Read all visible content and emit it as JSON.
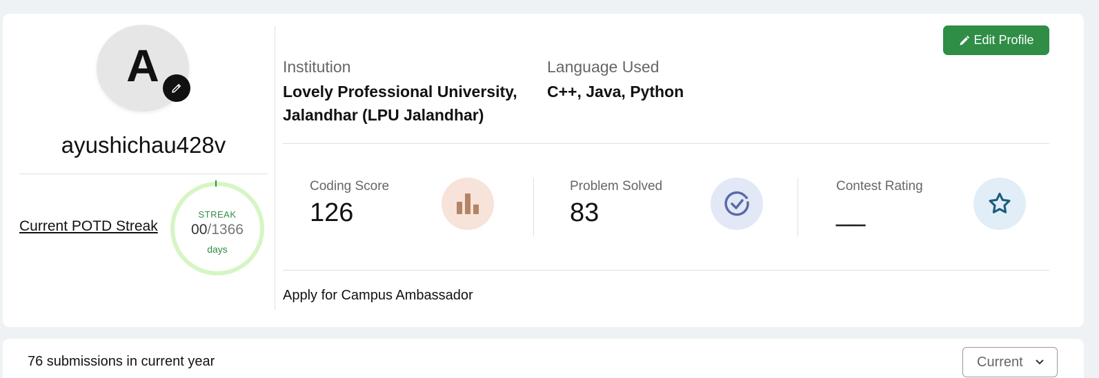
{
  "profile": {
    "avatar_letter": "A",
    "username": "ayushichau428v",
    "edit_profile_label": "Edit Profile"
  },
  "streak": {
    "link_text": "Current POTD Streak",
    "label": "STREAK",
    "current": "00",
    "separator": "/",
    "max": "1366",
    "unit": "days",
    "ring_color": "#d6f5c4",
    "accent_color": "#2f8d46"
  },
  "info": {
    "institution_label": "Institution",
    "institution_line1": "Lovely Professional University,",
    "institution_line2": "Jalandhar (LPU Jalandhar)",
    "language_label": "Language Used",
    "language_value": "C++, Java, Python"
  },
  "stats": [
    {
      "label": "Coding Score",
      "value": "126",
      "icon": "bar-chart-icon",
      "icon_bg": "#f7e3d9",
      "icon_color": "#b58466"
    },
    {
      "label": "Problem Solved",
      "value": "83",
      "icon": "check-circle-icon",
      "icon_bg": "#e3e8f6",
      "icon_color": "#5a6aa8"
    },
    {
      "label": "Contest Rating",
      "value": "__",
      "icon": "star-icon",
      "icon_bg": "#e1eef7",
      "icon_color": "#1c5d7e"
    }
  ],
  "campus_link": "Apply for Campus Ambassador",
  "submissions": {
    "text": "76 submissions in current year",
    "year_select": "Current"
  },
  "colors": {
    "brand_green": "#2f8d46",
    "page_bg": "#eef2f5"
  }
}
